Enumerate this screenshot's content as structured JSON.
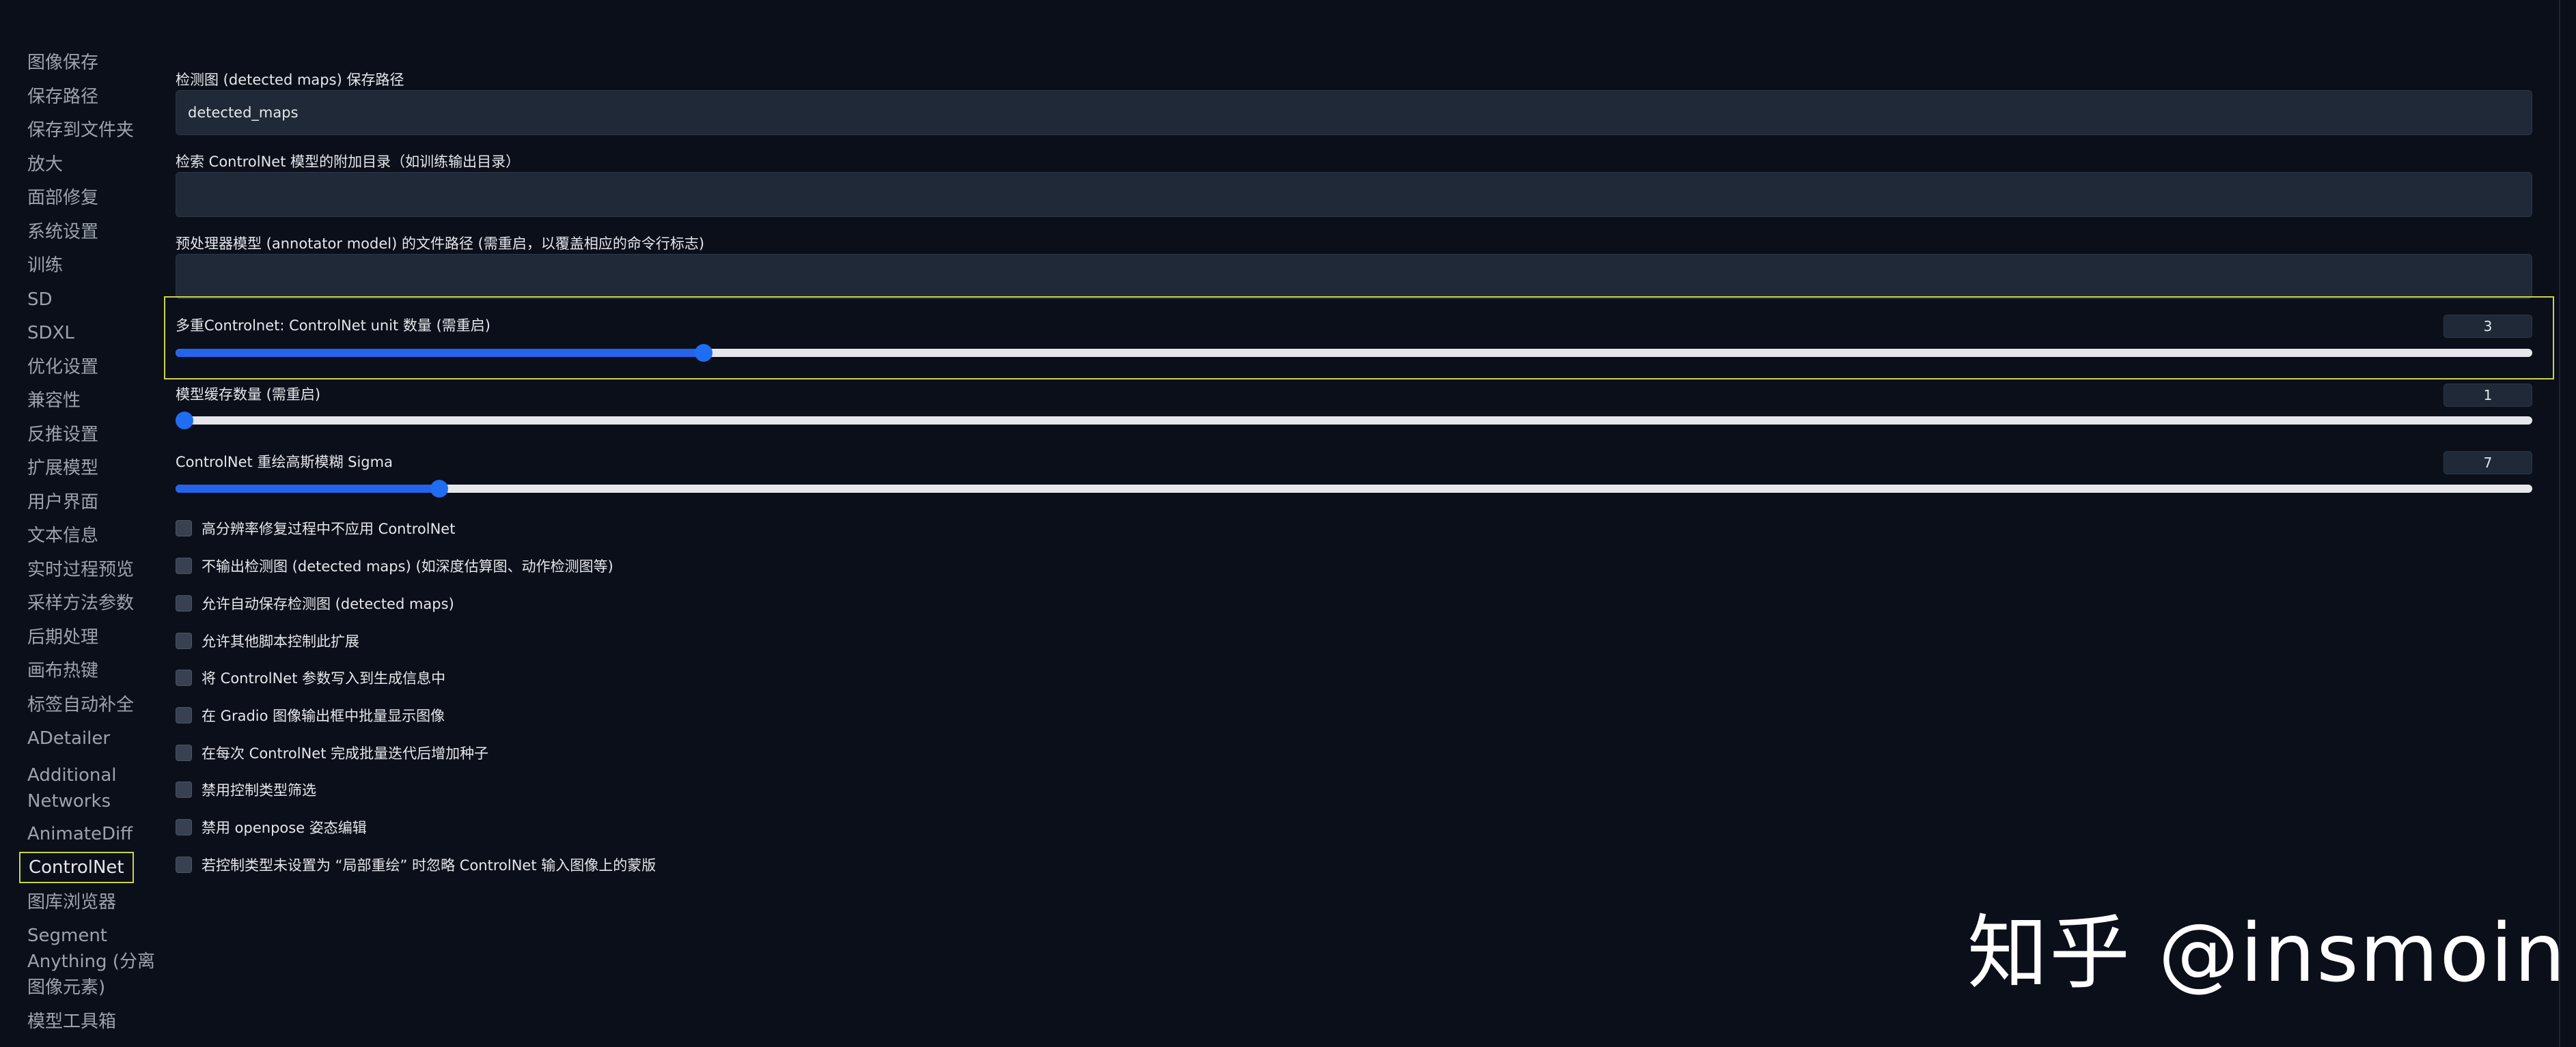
{
  "sidebar": {
    "items": [
      {
        "label": "图像保存"
      },
      {
        "label": "保存路径"
      },
      {
        "label": "保存到文件夹"
      },
      {
        "label": "放大"
      },
      {
        "label": "面部修复"
      },
      {
        "label": "系统设置"
      },
      {
        "label": "训练"
      },
      {
        "label": "SD"
      },
      {
        "label": "SDXL"
      },
      {
        "label": "优化设置"
      },
      {
        "label": "兼容性"
      },
      {
        "label": "反推设置"
      },
      {
        "label": "扩展模型"
      },
      {
        "label": "用户界面"
      },
      {
        "label": "文本信息"
      },
      {
        "label": "实时过程预览"
      },
      {
        "label": "采样方法参数"
      },
      {
        "label": "后期处理"
      },
      {
        "label": "画布热键"
      },
      {
        "label": "标签自动补全"
      },
      {
        "label": "ADetailer"
      },
      {
        "label": "Additional"
      },
      {
        "label": "Networks"
      },
      {
        "label": "AnimateDiff"
      },
      {
        "label": "ControlNet"
      },
      {
        "label": "图库浏览器"
      },
      {
        "label": "Segment"
      },
      {
        "label": "Anything (分离"
      },
      {
        "label": "图像元素)"
      },
      {
        "label": "模型工具箱"
      }
    ]
  },
  "settings": {
    "detected_maps_path": {
      "label": "检测图 (detected maps) 保存路径",
      "value": "detected_maps"
    },
    "extra_models_dir": {
      "label": "检索 ControlNet 模型的附加目录（如训练输出目录）",
      "value": ""
    },
    "annotator_path": {
      "label": "预处理器模型 (annotator model) 的文件路径 (需重启，以覆盖相应的命令行标志)",
      "value": ""
    },
    "multi_unit": {
      "label": "多重Controlnet: ControlNet unit 数量 (需重启)",
      "value": "3",
      "fraction": 0.224
    },
    "model_cache": {
      "label": "模型缓存数量 (需重启)",
      "value": "1",
      "fraction": 0.0
    },
    "blur_sigma": {
      "label": "ControlNet 重绘高斯模糊 Sigma",
      "value": "7",
      "fraction": 0.112
    }
  },
  "checkboxes": [
    {
      "label": "高分辨率修复过程中不应用 ControlNet"
    },
    {
      "label": "不输出检测图 (detected maps) (如深度估算图、动作检测图等)"
    },
    {
      "label": "允许自动保存检测图 (detected maps)"
    },
    {
      "label": "允许其他脚本控制此扩展"
    },
    {
      "label": "将 ControlNet 参数写入到生成信息中"
    },
    {
      "label": "在 Gradio 图像输出框中批量显示图像"
    },
    {
      "label": "在每次 ControlNet 完成批量迭代后增加种子"
    },
    {
      "label": "禁用控制类型筛选"
    },
    {
      "label": "禁用 openpose 姿态编辑"
    },
    {
      "label": "若控制类型未设置为 “局部重绘” 时忽略 ControlNet 输入图像上的蒙版"
    }
  ],
  "watermark": "知乎 @insmoin",
  "colors": {
    "accent": "#2563eb",
    "highlight": "#c9d44a",
    "background": "#0b0f19"
  }
}
